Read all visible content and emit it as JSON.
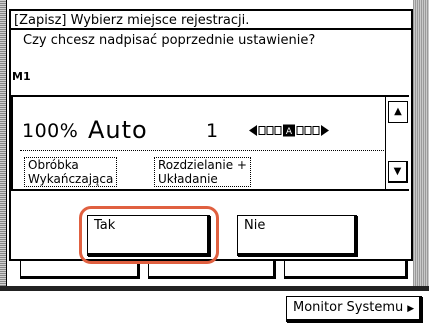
{
  "dialog": {
    "title": "[Zapisz] Wybierz miejsce rejestracji.",
    "question": "Czy chcesz nadpisać poprzednie ustawienie?",
    "slot": "M1"
  },
  "settings": {
    "ratio": "100%",
    "paper": "Auto",
    "quantity": "1",
    "finishing": [
      "Obróbka",
      "Wykańczająca"
    ],
    "collate": [
      "Rozdzielanie +",
      "Układanie"
    ]
  },
  "scroll": {
    "up_icon": "triangle-up-icon",
    "down_icon": "triangle-down-icon"
  },
  "buttons": {
    "yes": "Tak",
    "no": "Nie"
  },
  "footer": {
    "monitor": "Monitor Systemu"
  },
  "colors": {
    "highlight": "#e06040"
  }
}
